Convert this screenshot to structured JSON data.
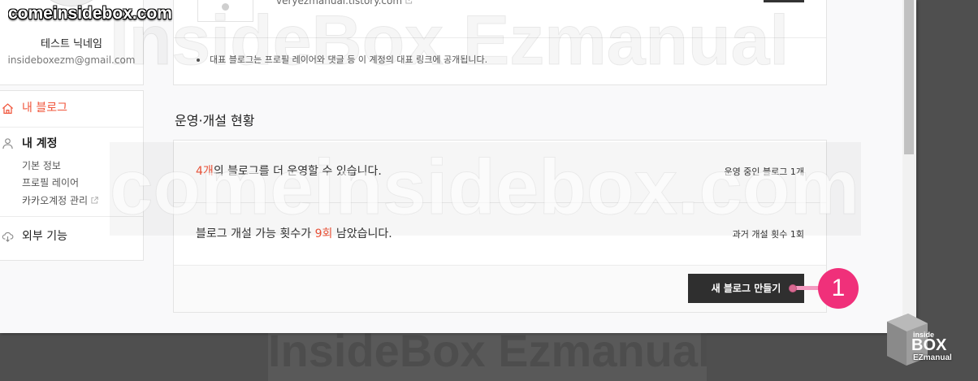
{
  "colors": {
    "accent": "#f0543a",
    "button_bg": "#2f2f2f",
    "annotation": "#f0307a",
    "annotation_line": "#f39ac0"
  },
  "watermarks": {
    "corner_text": "comeinsidebox.com",
    "top_text": "InsideBox Ezmanual",
    "middle_text": "comeinsidebox.com",
    "bottom_text": "InsideBox Ezmanual",
    "logo": {
      "line1": "inside",
      "line2": "BOX",
      "line3": "EZmanual"
    }
  },
  "sidebar": {
    "profile": {
      "nickname": "테스트 닉네임",
      "email": "insideboxezm@gmail.com"
    },
    "nav": [
      {
        "label": "내 블로그",
        "icon": "home-icon",
        "active": true
      },
      {
        "label": "내 계정",
        "icon": "person-icon",
        "children": [
          {
            "label": "기본 정보"
          },
          {
            "label": "프로필 레이어"
          },
          {
            "label": "카카오계정 관리",
            "icon": "external-link-icon"
          }
        ]
      },
      {
        "label": "외부 기능",
        "icon": "cloud-download-icon"
      }
    ]
  },
  "main": {
    "representative_blog": {
      "url": "veryezmanual.tistory.com",
      "url_icon": "external-link-icon",
      "notice": "대표 블로그는 프로필 레이어와 댓글 등 이 계정의 대표 링크에 공개됩니다."
    },
    "status": {
      "title": "운영·개설 현황",
      "rows": [
        {
          "highlight": "4개",
          "text": "의 블로그를 더 운영할 수 있습니다.",
          "side": "운영 중인 블로그 1개"
        },
        {
          "prefix": "블로그 개설 가능 횟수가 ",
          "highlight": "9회",
          "text": " 남았습니다.",
          "side": "과거 개설 횟수 1회"
        }
      ],
      "create_button": "새 블로그 만들기"
    }
  },
  "annotation": {
    "number": "1"
  }
}
